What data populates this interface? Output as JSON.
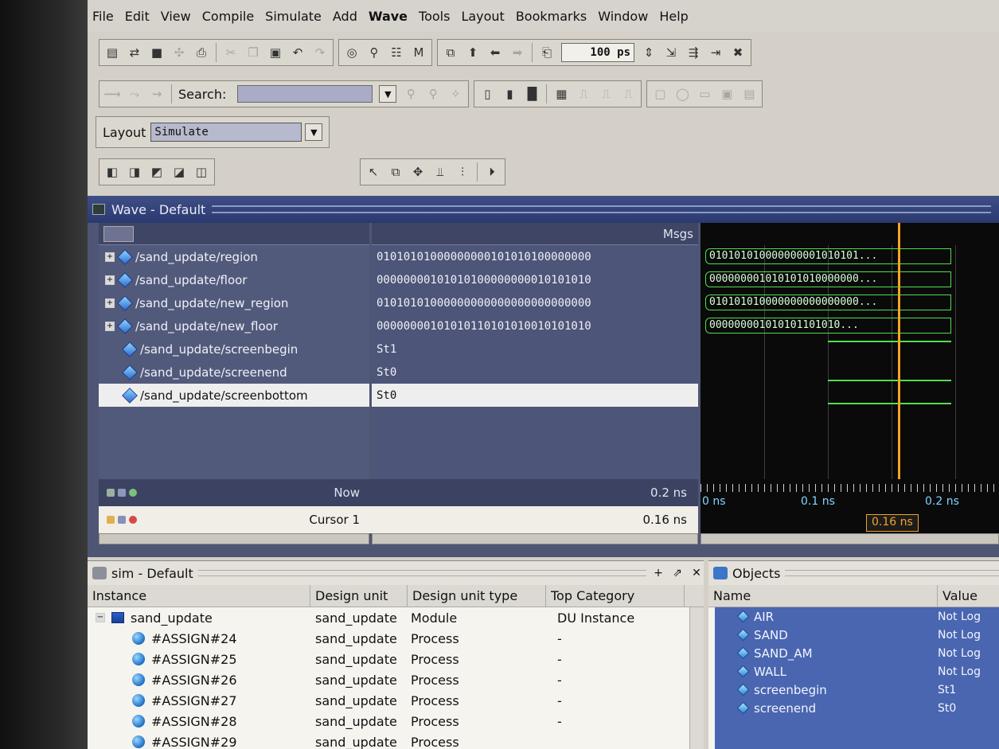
{
  "menu": [
    "File",
    "Edit",
    "View",
    "Compile",
    "Simulate",
    "Add",
    "Wave",
    "Tools",
    "Layout",
    "Bookmarks",
    "Window",
    "Help"
  ],
  "toolbar": {
    "search_label": "Search:",
    "time_value": "100 ps"
  },
  "layout": {
    "label": "Layout",
    "value": "Simulate"
  },
  "wave": {
    "title": "Wave - Default",
    "msgs_header": "Msgs",
    "signals": [
      {
        "name": "/sand_update/region",
        "value": "01010101000000000101010100000000",
        "wave": "010101010000000001010101..."
      },
      {
        "name": "/sand_update/floor",
        "value": "00000000101010100000000010101010",
        "wave": "000000001010101010000000..."
      },
      {
        "name": "/sand_update/new_region",
        "value": "01010101000000000000000000000000",
        "wave": "010101010000000000000000..."
      },
      {
        "name": "/sand_update/new_floor",
        "value": "00000000101010110101010010101010",
        "wave": "000000001010101101010..."
      },
      {
        "name": "/sand_update/screenbegin",
        "value": "St1"
      },
      {
        "name": "/sand_update/screenend",
        "value": "St0"
      },
      {
        "name": "/sand_update/screenbottom",
        "value": "St0"
      }
    ],
    "now_label": "Now",
    "now_value": "0.2 ns",
    "cursor_label": "Cursor 1",
    "cursor_value": "0.16 ns",
    "timeline_ticks": [
      "0 ns",
      "0.1 ns",
      "0.2 ns"
    ],
    "cursor_tag": "0.16 ns"
  },
  "sim": {
    "title": "sim - Default",
    "columns": [
      "Instance",
      "Design unit",
      "Design unit type",
      "Top Category"
    ],
    "rows": [
      {
        "instance": "sand_update",
        "unit": "sand_update",
        "type": "Module",
        "category": "DU Instance"
      },
      {
        "instance": "#ASSIGN#24",
        "unit": "sand_update",
        "type": "Process",
        "category": "-"
      },
      {
        "instance": "#ASSIGN#25",
        "unit": "sand_update",
        "type": "Process",
        "category": "-"
      },
      {
        "instance": "#ASSIGN#26",
        "unit": "sand_update",
        "type": "Process",
        "category": "-"
      },
      {
        "instance": "#ASSIGN#27",
        "unit": "sand_update",
        "type": "Process",
        "category": "-"
      },
      {
        "instance": "#ASSIGN#28",
        "unit": "sand_update",
        "type": "Process",
        "category": "-"
      },
      {
        "instance": "#ASSIGN#29",
        "unit": "sand_update",
        "type": "Process",
        "category": ""
      }
    ]
  },
  "objects": {
    "title": "Objects",
    "columns": [
      "Name",
      "Value"
    ],
    "rows": [
      {
        "name": "AIR",
        "value": "Not Log"
      },
      {
        "name": "SAND",
        "value": "Not Log"
      },
      {
        "name": "SAND_AM",
        "value": "Not Log"
      },
      {
        "name": "WALL",
        "value": "Not Log"
      },
      {
        "name": "screenbegin",
        "value": "St1"
      },
      {
        "name": "screenend",
        "value": "St0"
      }
    ]
  },
  "colors": {
    "wave_green": "#4ee04e",
    "cursor_orange": "#f3a22b",
    "selection_blue": "#4a66b0"
  }
}
